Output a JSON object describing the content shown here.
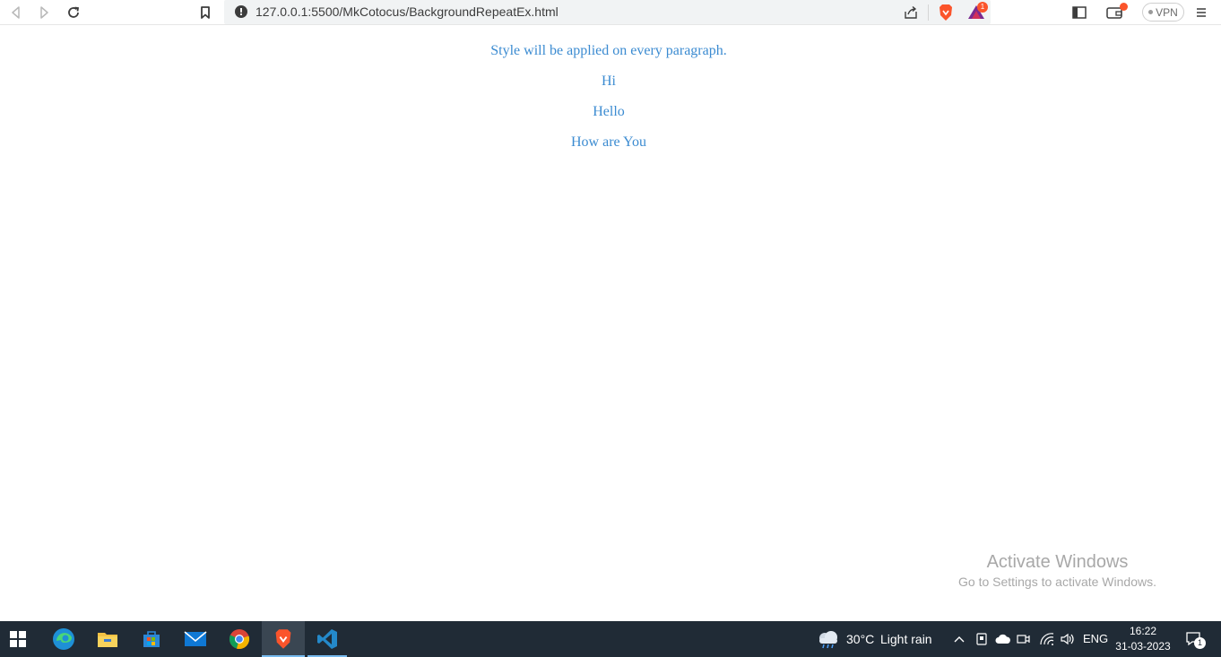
{
  "browser": {
    "url": "127.0.0.1:5500/MkCotocus/BackgroundRepeatEx.html",
    "vpn_label": "VPN",
    "alerts_badge": "1",
    "accent_color": "#fb542b"
  },
  "page": {
    "paragraphs": [
      "Style will be applied on every paragraph.",
      "Hi",
      "Hello",
      "How are You"
    ],
    "text_color": "#3b8bd1"
  },
  "watermark": {
    "title": "Activate Windows",
    "subtitle": "Go to Settings to activate Windows."
  },
  "taskbar": {
    "weather_temp": "30°C",
    "weather_desc": "Light rain",
    "language": "ENG",
    "time": "16:22",
    "date": "31-03-2023",
    "notification_count": "1",
    "apps": [
      "start-icon",
      "edge-icon",
      "file-explorer-icon",
      "store-icon",
      "mail-icon",
      "chrome-icon",
      "brave-icon",
      "vscode-icon"
    ]
  }
}
